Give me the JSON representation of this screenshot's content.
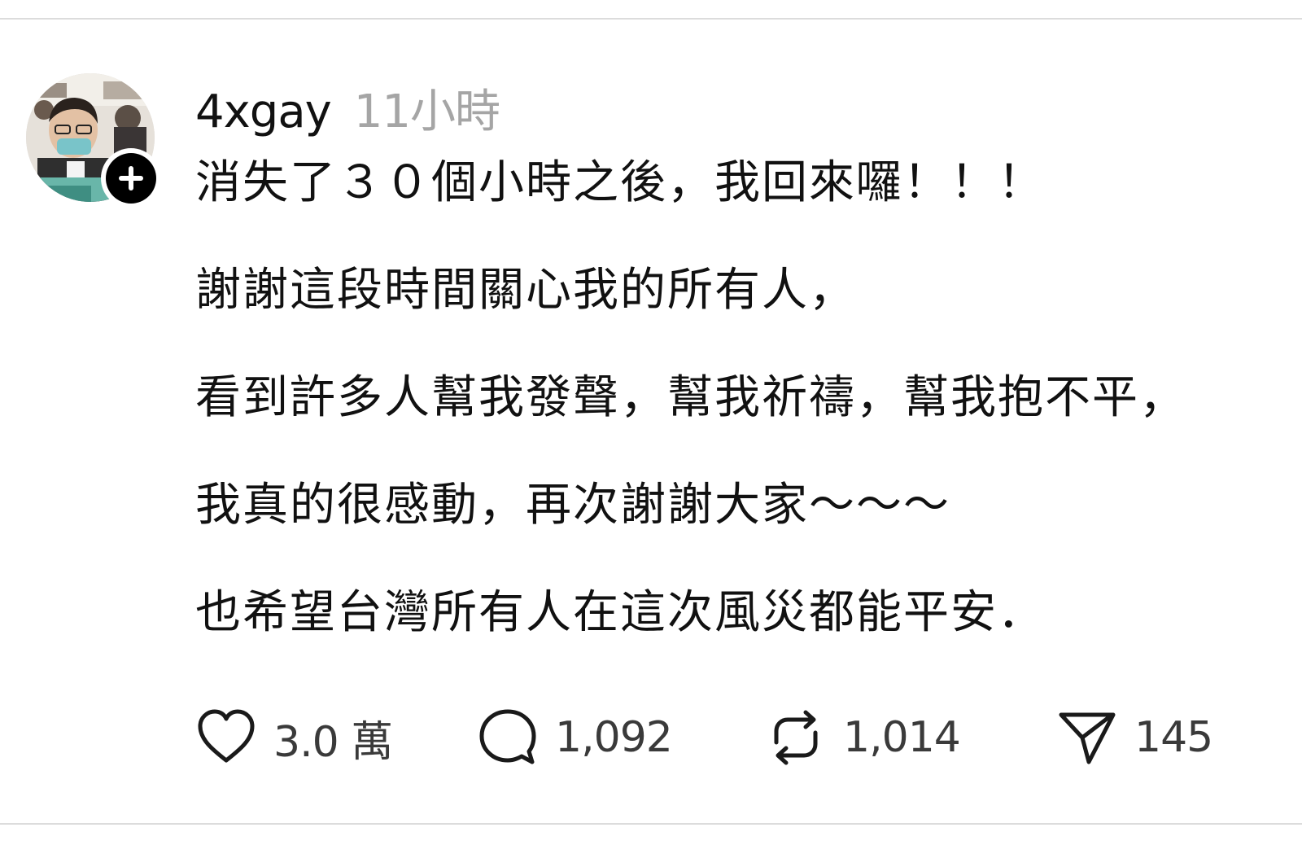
{
  "post": {
    "author": {
      "username": "4xgay",
      "avatar_icon": "profile-photo",
      "follow_icon": "plus-icon"
    },
    "timestamp": "11小時",
    "lines": [
      "消失了３０個小時之後，我回來囉！！！",
      "謝謝這段時間關心我的所有人，",
      "看到許多人幫我發聲，幫我祈禱，幫我抱不平，",
      "我真的很感動，再次謝謝大家～～～",
      "也希望台灣所有人在這次風災都能平安．"
    ],
    "actions": {
      "like": {
        "icon": "heart-icon",
        "count": "3.0 萬"
      },
      "comment": {
        "icon": "comment-bubble-icon",
        "count": "1,092"
      },
      "repost": {
        "icon": "repost-icon",
        "count": "1,014"
      },
      "share": {
        "icon": "send-icon",
        "count": "145"
      }
    }
  },
  "colors": {
    "text": "#111111",
    "muted": "#a5a5a5",
    "divider": "#dcdcdc",
    "background": "#ffffff"
  }
}
